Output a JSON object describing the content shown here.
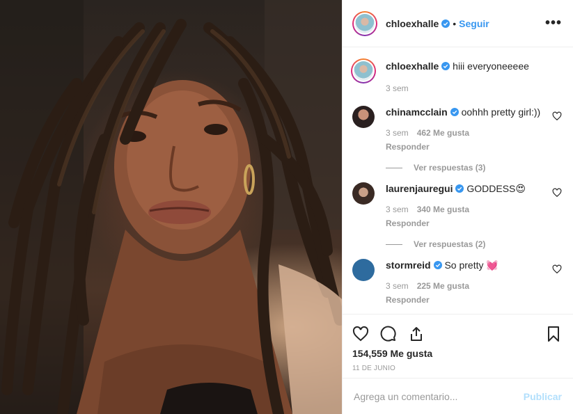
{
  "header": {
    "username": "chloexhalle",
    "separator": "•",
    "follow_label": "Seguir",
    "more_icon": "more-options-icon"
  },
  "caption": {
    "username": "chloexhalle",
    "text": "hiii everyoneeeee",
    "time": "3 sem"
  },
  "comments": [
    {
      "username": "chinamcclain",
      "text": "oohhh pretty girl:))",
      "time": "3 sem",
      "likes": "462 Me gusta",
      "reply_label": "Responder",
      "view_replies": "Ver respuestas (3)"
    },
    {
      "username": "laurenjauregui",
      "text": "GODDESS",
      "emoji": "😍",
      "time": "3 sem",
      "likes": "340 Me gusta",
      "reply_label": "Responder",
      "view_replies": "Ver respuestas (2)"
    },
    {
      "username": "stormreid",
      "text": "So pretty",
      "emoji": "💓",
      "time": "3 sem",
      "likes": "225 Me gusta",
      "reply_label": "Responder"
    }
  ],
  "actions": {
    "likes_count": "154,559 Me gusta",
    "date": "11 de junio"
  },
  "add_comment": {
    "placeholder": "Agrega un comentario...",
    "publish_label": "Publicar"
  },
  "colors": {
    "accent": "#3897f0",
    "verified": "#3897f0",
    "stormreid_avatar": "#2e6b9e",
    "publish_disabled": "#b2dffc"
  }
}
